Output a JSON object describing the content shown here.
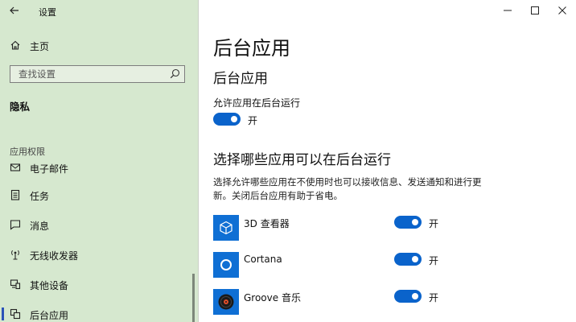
{
  "window": {
    "app_title": "设置",
    "controls": [
      "minimize",
      "maximize",
      "close"
    ]
  },
  "sidebar": {
    "home_label": "主页",
    "search_placeholder": "查找设置",
    "section_title": "隐私",
    "group_title": "应用权限",
    "items": [
      {
        "label": "电子邮件",
        "icon": "mail-icon",
        "active": false
      },
      {
        "label": "任务",
        "icon": "tasks-icon",
        "active": false
      },
      {
        "label": "消息",
        "icon": "message-icon",
        "active": false
      },
      {
        "label": "无线收发器",
        "icon": "radio-icon",
        "active": false
      },
      {
        "label": "其他设备",
        "icon": "devices-icon",
        "active": false
      },
      {
        "label": "后台应用",
        "icon": "background-apps-icon",
        "active": true
      }
    ]
  },
  "main": {
    "page_title": "后台应用",
    "sub_title": "后台应用",
    "allow_label": "允许应用在后台运行",
    "allow_toggle_state": "开",
    "choose_title": "选择哪些应用可以在后台运行",
    "choose_desc": "选择允许哪些应用在不使用时也可以接收信息、发送通知和进行更新。关闭后台应用有助于省电。",
    "apps": [
      {
        "name": "3D 查看器",
        "icon": "3d-viewer-icon",
        "state": "开"
      },
      {
        "name": "Cortana",
        "icon": "cortana-icon",
        "state": "开"
      },
      {
        "name": "Groove 音乐",
        "icon": "groove-music-icon",
        "state": "开"
      }
    ]
  },
  "colors": {
    "sidebar_bg": "#d6e8cf",
    "accent": "#0a63cb",
    "app_tile": "#0f6fd4"
  }
}
